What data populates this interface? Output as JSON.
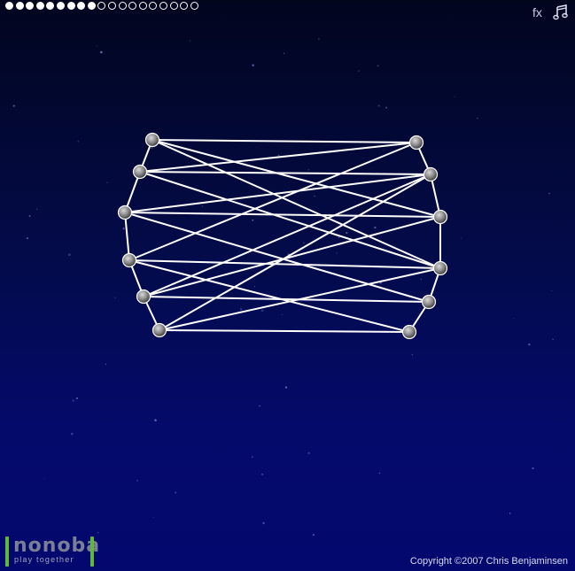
{
  "progress": {
    "completed": 9,
    "total": 19
  },
  "toolbar": {
    "fx_label": "fx",
    "music_icon": "music-note-icon"
  },
  "logo": {
    "wordmark": "nonoba",
    "tagline": "play together"
  },
  "copyright": "Copyright ©2007 Chris Benjaminsen",
  "colors": {
    "line": "#ffffff",
    "node": "#8a8a8a",
    "progress": "#ffffff",
    "logo_bar": "#5fb83a"
  },
  "graph": {
    "nodes": [
      {
        "id": 0
      },
      {
        "id": 1
      },
      {
        "id": 2
      },
      {
        "id": 3
      },
      {
        "id": 4
      },
      {
        "id": 5
      },
      {
        "id": 6
      },
      {
        "id": 7
      },
      {
        "id": 8
      },
      {
        "id": 9
      },
      {
        "id": 10
      },
      {
        "id": 11
      }
    ],
    "edges": [
      [
        0,
        1
      ],
      [
        1,
        2
      ],
      [
        2,
        3
      ],
      [
        3,
        4
      ],
      [
        4,
        5
      ],
      [
        6,
        7
      ],
      [
        7,
        8
      ],
      [
        8,
        9
      ],
      [
        9,
        10
      ],
      [
        10,
        11
      ],
      [
        0,
        6
      ],
      [
        1,
        7
      ],
      [
        4,
        10
      ],
      [
        5,
        11
      ],
      [
        0,
        8
      ],
      [
        0,
        9
      ],
      [
        1,
        6
      ],
      [
        1,
        9
      ],
      [
        2,
        7
      ],
      [
        2,
        10
      ],
      [
        3,
        6
      ],
      [
        3,
        11
      ],
      [
        4,
        7
      ],
      [
        4,
        8
      ],
      [
        5,
        7
      ],
      [
        5,
        9
      ],
      [
        2,
        8
      ],
      [
        3,
        9
      ]
    ]
  }
}
